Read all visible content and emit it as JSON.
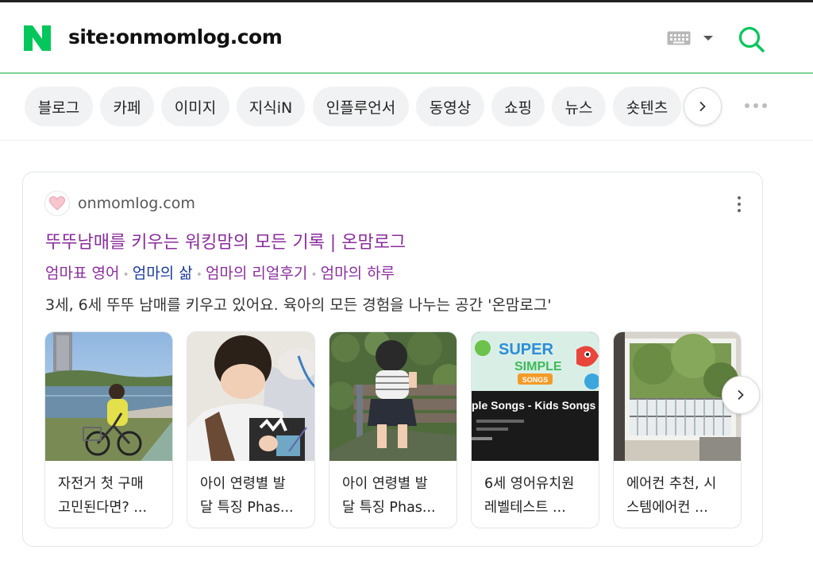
{
  "header": {
    "logo_letter": "N",
    "query": "site:onmomlog.com",
    "brand_color": "#03c75a"
  },
  "tabs": [
    {
      "label": "블로그"
    },
    {
      "label": "카페"
    },
    {
      "label": "이미지"
    },
    {
      "label": "지식iN"
    },
    {
      "label": "인플루언서"
    },
    {
      "label": "동영상"
    },
    {
      "label": "쇼핑"
    },
    {
      "label": "뉴스"
    },
    {
      "label": "숏텐츠"
    }
  ],
  "result": {
    "site": "onmomlog.com",
    "title": "뚜뚜남매를 키우는 워킹맘의 모든 기록 | 온맘로그",
    "sublinks": [
      {
        "label": "엄마표 영어"
      },
      {
        "label": "엄마의 삶"
      },
      {
        "label": "엄마의 리얼후기"
      },
      {
        "label": "엄마의 하루"
      }
    ],
    "description": "3세, 6세 뚜뚜 남매를 키우고 있어요. 육아의 모든 경험을 나누는 공간 '온맘로그'",
    "thumbnails": [
      {
        "line1": "자전거 첫 구매",
        "line2": "고민된다면? ..."
      },
      {
        "line1": "아이 연령별 발",
        "line2": "달 특징 Phas..."
      },
      {
        "line1": "아이 연령별 발",
        "line2": "달 특징 Phas..."
      },
      {
        "line1": "6세 영어유치원",
        "line2": "레벨테스트 ..."
      },
      {
        "line1": "에어컨 추천, 시",
        "line2": "스템에어컨 ..."
      }
    ],
    "thumb4_texts": {
      "video_title": "ple Songs - Kids Songs",
      "brand_super": "SUPER",
      "brand_simple": "SIMPLE",
      "brand_songs": "SONGS"
    }
  }
}
